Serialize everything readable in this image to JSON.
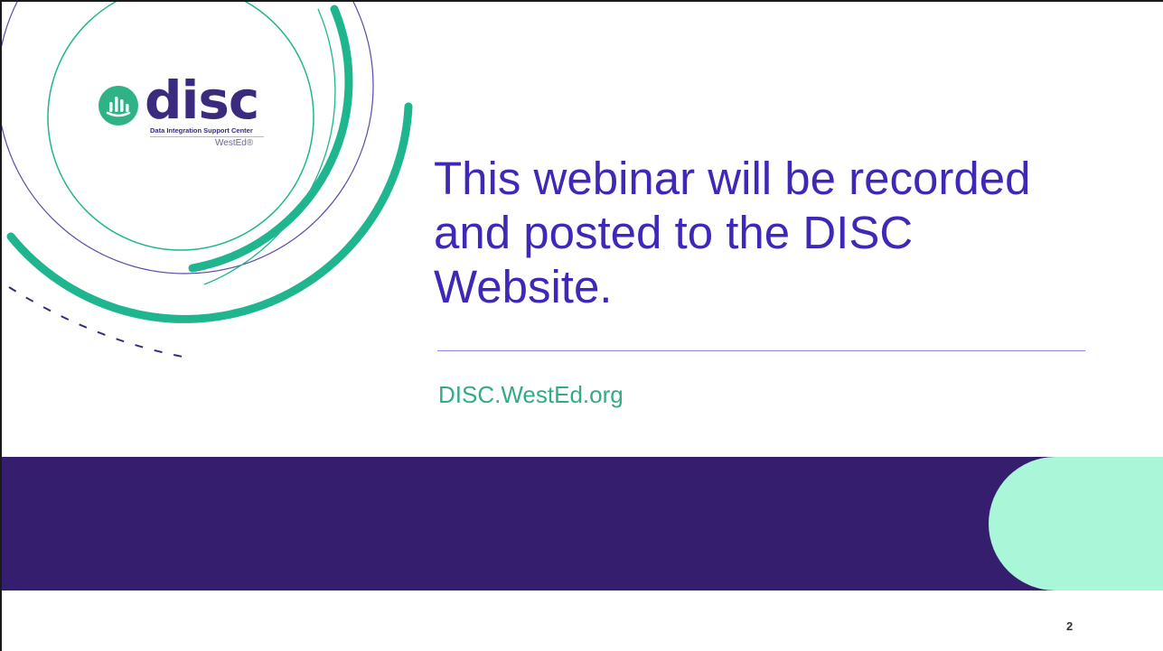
{
  "logo": {
    "wordmark": "disc",
    "subtitle": "Data Integration Support Center",
    "brand": "WestEd",
    "brand_mark": "®"
  },
  "headline": "This webinar will be recorded and posted to the DISC Website.",
  "website": "DISC.WestEd.org",
  "page_number": "2",
  "colors": {
    "headline": "#3f27b7",
    "website": "#32ab86",
    "band": "#351e6e",
    "band_shape": "#a9f7d8",
    "ring_teal": "#1fb58f",
    "ring_purple": "#3b2a7e"
  }
}
